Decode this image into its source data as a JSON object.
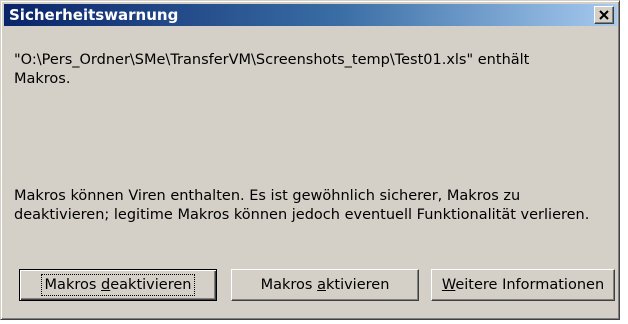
{
  "window": {
    "title": "Sicherheitswarnung",
    "close_icon": "close-icon"
  },
  "message": {
    "path_text": "\"O:\\Pers_Ordner\\SMe\\TransferVM\\Screenshots_temp\\Test01.xls\" enthält\nMakros.",
    "warning_text": "Makros können Viren enthalten. Es ist gewöhnlich sicherer, Makros zu\ndeaktivieren; legitime Makros können jedoch eventuell Funktionalität verlieren."
  },
  "buttons": {
    "disable": {
      "before": "Makros ",
      "accel": "d",
      "after": "eaktivieren"
    },
    "enable": {
      "before": "Makros ",
      "accel": "a",
      "after": "ktivieren"
    },
    "info": {
      "before": "",
      "accel": "W",
      "after": "eitere Informationen"
    }
  },
  "colors": {
    "dialog_bg": "#d4d0c8",
    "title_gradient_start": "#0a246a",
    "title_gradient_end": "#a6caf0",
    "title_text": "#ffffff"
  }
}
